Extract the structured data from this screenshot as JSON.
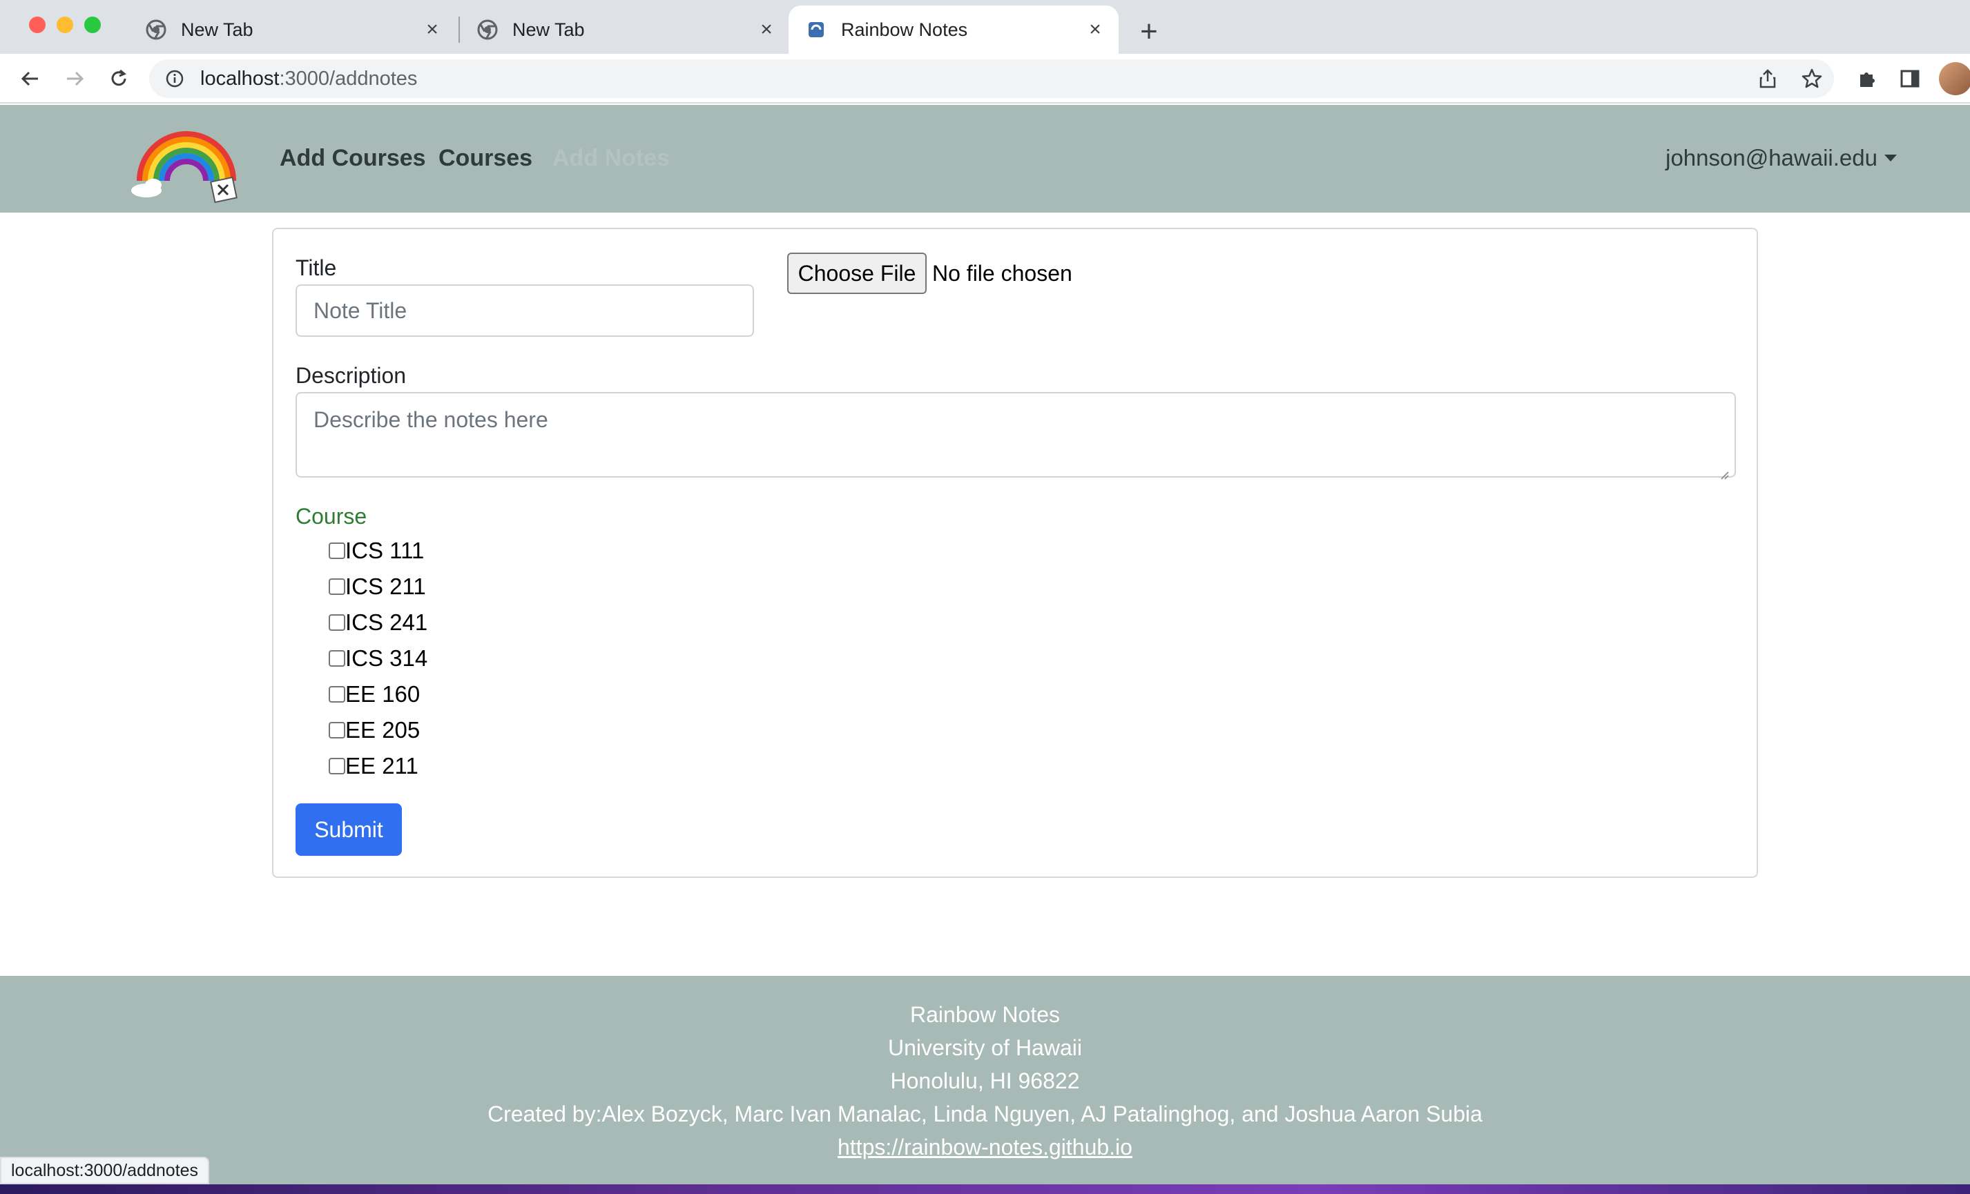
{
  "browser": {
    "tabs": [
      {
        "title": "New Tab",
        "active": false
      },
      {
        "title": "New Tab",
        "active": false
      },
      {
        "title": "Rainbow Notes",
        "active": true
      }
    ],
    "url_host": "localhost",
    "url_path": ":3000/addnotes"
  },
  "navbar": {
    "links": [
      "Add Courses",
      "Courses"
    ],
    "faded_link": "Add Notes",
    "user": "johnson@hawaii.edu"
  },
  "form": {
    "title_label": "Title",
    "title_placeholder": "Note Title",
    "file_button": "Choose File",
    "file_status": "No file chosen",
    "description_label": "Description",
    "description_placeholder": "Describe the notes here",
    "course_label": "Course",
    "courses": [
      "ICS 111",
      "ICS 211",
      "ICS 241",
      "ICS 314",
      "EE 160",
      "EE 205",
      "EE 211"
    ],
    "submit_label": "Submit"
  },
  "footer": {
    "line1": "Rainbow Notes",
    "line2": "University of Hawaii",
    "line3": "Honolulu, HI 96822",
    "line4": "Created by:Alex Bozyck, Marc Ivan Manalac, Linda Nguyen, AJ Patalinghog, and Joshua Aaron Subia",
    "link": "https://rainbow-notes.github.io"
  },
  "status_bar_url": "localhost:3000/addnotes"
}
